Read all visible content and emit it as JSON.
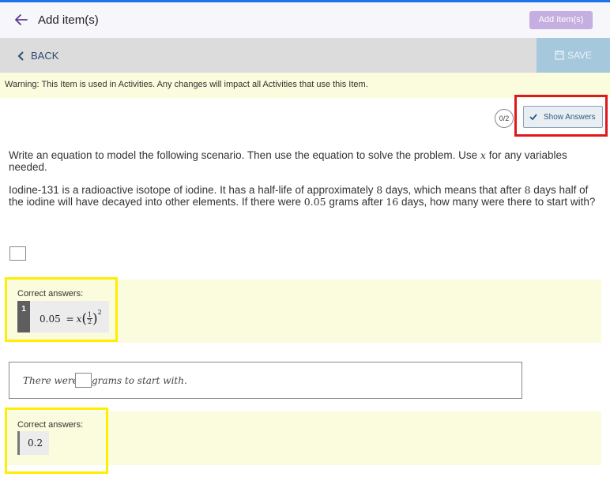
{
  "header": {
    "title": "Add item(s)",
    "add_button": "Add Item(s)",
    "accent": "#1f73e8"
  },
  "toolbar": {
    "back_label": "BACK",
    "save_label": "SAVE"
  },
  "warning": "Warning: This Item is used in Activities. Any changes will impact all Activities that use this Item.",
  "score": "0/2",
  "show_answers_label": "Show Answers",
  "question": {
    "p1_a": "Write an equation to model the following scenario. Then use the equation to solve the problem. Use ",
    "p1_var": "x",
    "p1_b": " for any variables needed.",
    "p2_a": "Iodine-131 is a radioactive isotope of iodine. It has a half-life of approximately ",
    "p2_n1": "8",
    "p2_b": " days, which means that after ",
    "p2_n2": "8",
    "p2_c": " days half of the iodine will have decayed into other elements. If there were ",
    "p2_n3": "0.05",
    "p2_d": " grams after ",
    "p2_n4": "16",
    "p2_e": " days, how many were there to start with?"
  },
  "correct1": {
    "label": "Correct answers:",
    "index": "1",
    "equation": {
      "lhs": "0.05",
      "eq": "=",
      "var": "x",
      "num": "1",
      "den": "2",
      "exp": "2"
    }
  },
  "sentence": {
    "before": "There were",
    "after": "grams to start with."
  },
  "correct2": {
    "label": "Correct answers:",
    "value": "0.2"
  }
}
